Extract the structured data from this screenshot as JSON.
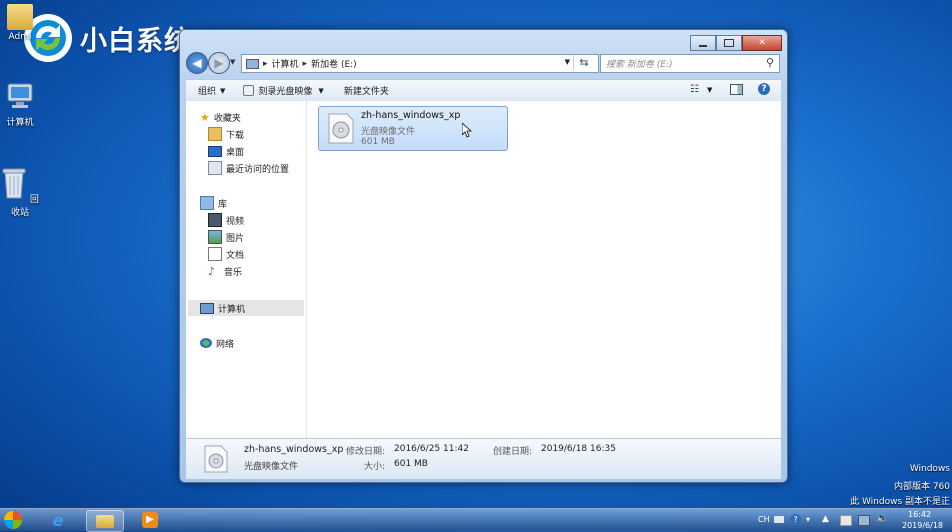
{
  "brand": {
    "logo_text": "小白系统"
  },
  "desktop": {
    "icons": [
      {
        "label": "Admi"
      },
      {
        "label": "计算机"
      },
      {
        "label": "回收站"
      }
    ]
  },
  "window": {
    "caption": {
      "minimize": "▭",
      "maximize": "□",
      "close": "✕"
    },
    "address": {
      "segments": [
        "计算机",
        "新加卷 (E:)"
      ]
    },
    "search": {
      "placeholder": "搜索 新加卷 (E:)"
    },
    "toolbar": {
      "organize": "组织",
      "burn": "刻录光盘映像",
      "new_folder": "新建文件夹"
    },
    "nav": {
      "favorites": {
        "label": "收藏夹",
        "items": [
          "下载",
          "桌面",
          "最近访问的位置"
        ]
      },
      "libraries": {
        "label": "库",
        "items": [
          "视频",
          "图片",
          "文档",
          "音乐"
        ]
      },
      "computer": "计算机",
      "network": "网络"
    },
    "file": {
      "name": "zh-hans_windows_xp",
      "type": "光盘映像文件",
      "size": "601 MB"
    },
    "details": {
      "name": "zh-hans_windows_xp",
      "type": "光盘映像文件",
      "modified_label": "修改日期:",
      "modified_value": "2016/6/25 11:42",
      "size_label": "大小:",
      "size_value": "601 MB",
      "created_label": "创建日期:",
      "created_value": "2019/6/18 16:35"
    }
  },
  "watermark": {
    "line1": "Windows",
    "line2": "内部版本 760",
    "line3": "此 Windows 副本不是正"
  },
  "taskbar": {
    "lang": "CH",
    "time": "16:42",
    "date": "2019/6/18"
  },
  "colors": {
    "accent": "#1a6fcd",
    "selection": "#c4ddfb"
  }
}
